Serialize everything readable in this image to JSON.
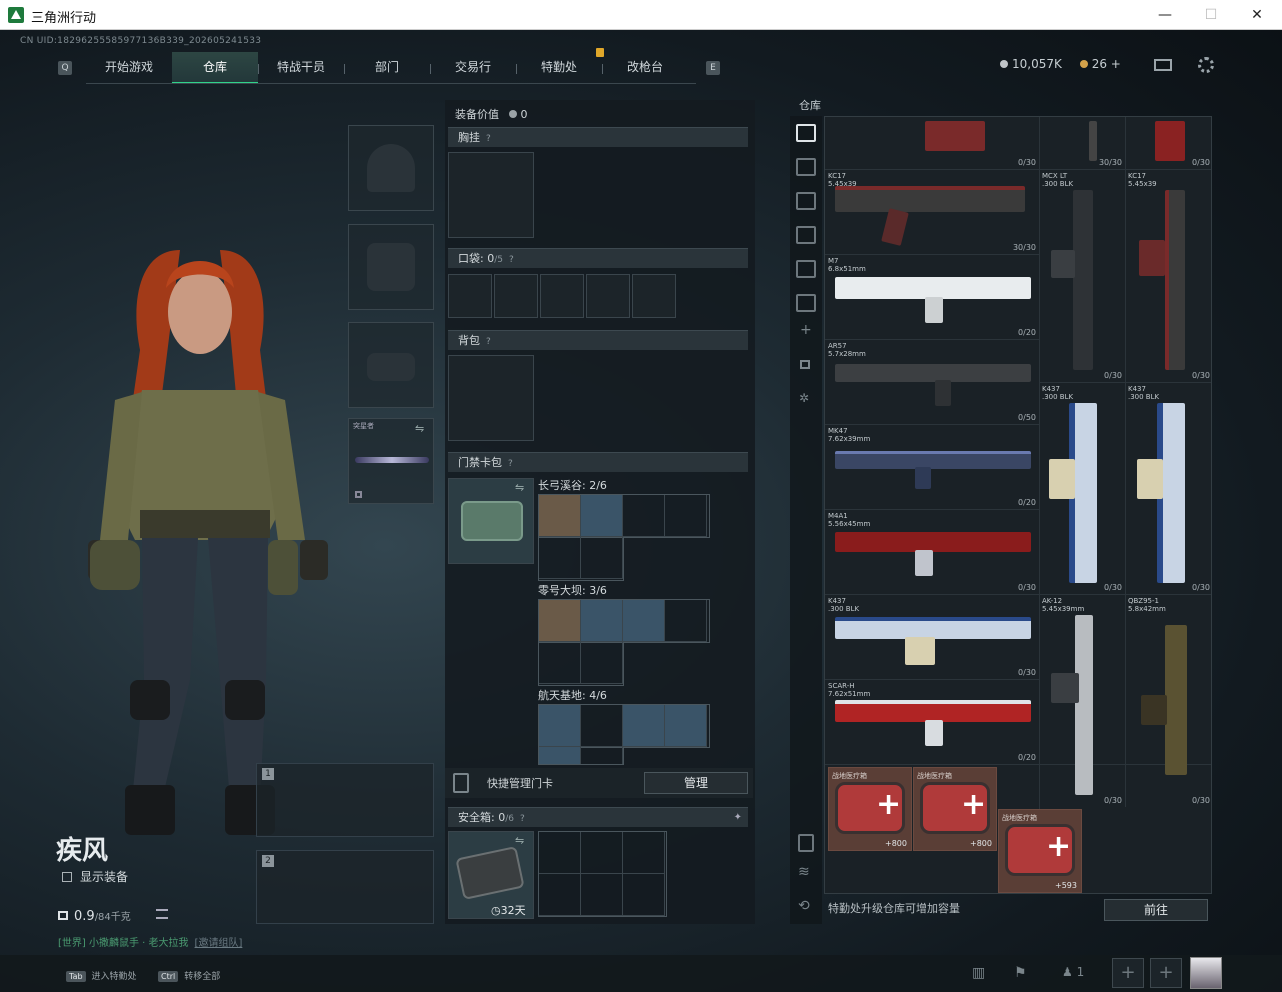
{
  "window": {
    "title": "三角洲行动",
    "minimize": "—",
    "maximize": "☐",
    "close": "✕"
  },
  "uid": "CN UID:18296255585977136B339_202605241533",
  "nav": {
    "left_key": "Q",
    "right_key": "E",
    "tabs": [
      "开始游戏",
      "仓库",
      "特战干员",
      "部门",
      "交易行",
      "特勤处",
      "改枪台"
    ],
    "active": "仓库"
  },
  "currency": {
    "coins": "10,057K",
    "tickets": "26",
    "plus": "+",
    "coin_color": "#c0c4c8",
    "ticket_color": "#d4a24a"
  },
  "character": {
    "name": "疾风",
    "show_equipment": "显示装备",
    "weight_value": "0.9",
    "weight_cap": "/84千克",
    "chat_channel": "[世界]",
    "chat_text": "小撒麟鼠手 · 老大拉我",
    "chat_link": "[邀请组队]"
  },
  "equip_panel": {
    "secure_label": "安全箱",
    "weapon_slot_1": "1",
    "weapon_slot_2": "2",
    "pouch_label": "安全箱"
  },
  "mid": {
    "equip_value_label": "装备价值",
    "equip_value": "0",
    "chest_rig": "胸挂",
    "pockets": "口袋:",
    "pockets_count": "0",
    "pockets_cap": "/5",
    "backpack": "背包",
    "keycard_case": "门禁卡包",
    "groups": [
      {
        "name": "长弓溪谷:",
        "count": "2/6"
      },
      {
        "name": "零号大坝:",
        "count": "3/6"
      },
      {
        "name": "航天基地:",
        "count": "4/6"
      }
    ],
    "quick_manage": "快捷管理门卡",
    "manage_btn": "管理",
    "safe_box": "安全箱:",
    "safe_count": "0",
    "safe_cap": "/6",
    "safe_days": "32天",
    "help": "?"
  },
  "storage": {
    "title": "仓库",
    "footer_text": "特勤处升级仓库可增加容量",
    "go_btn": "前往",
    "weapons": [
      {
        "name": "",
        "caliber": "",
        "count": "0/30"
      },
      {
        "name": "",
        "caliber": "",
        "count": "30/30"
      },
      {
        "name": "",
        "caliber": "",
        "count": "0/30"
      },
      {
        "name": "KC17",
        "caliber": "5.45x39",
        "count": "30/30"
      },
      {
        "name": "MCX LT",
        "caliber": ".300 BLK",
        "count": "0/30"
      },
      {
        "name": "KC17",
        "caliber": "5.45x39",
        "count": "0/30"
      },
      {
        "name": "M7",
        "caliber": "6.8x51mm",
        "count": "0/20"
      },
      {
        "name": "AR57",
        "caliber": "5.7x28mm",
        "count": "0/50"
      },
      {
        "name": "K437",
        "caliber": ".300 BLK",
        "count": "0/30"
      },
      {
        "name": "K437",
        "caliber": ".300 BLK",
        "count": "0/30"
      },
      {
        "name": "MK47",
        "caliber": "7.62x39mm",
        "count": "0/20"
      },
      {
        "name": "M4A1",
        "caliber": "5.56x45mm",
        "count": "0/30"
      },
      {
        "name": "K437",
        "caliber": ".300 BLK",
        "count": "0/30"
      },
      {
        "name": "AK-12",
        "caliber": "5.45x39mm",
        "count": "0/30"
      },
      {
        "name": "QBZ95-1",
        "caliber": "5.8x42mm",
        "count": "0/30"
      },
      {
        "name": "SCAR-H",
        "caliber": "7.62x51mm",
        "count": "0/20"
      }
    ],
    "medkits": [
      {
        "name": "战地医疗箱",
        "count": "+800"
      },
      {
        "name": "战地医疗箱",
        "count": "+800"
      },
      {
        "name": "战地医疗箱",
        "count": "+593"
      }
    ]
  },
  "bottom": {
    "tab_key": "Tab",
    "tab_text": "进入特勤处",
    "ctrl_key": "Ctrl",
    "ctrl_text": "转移全部",
    "friends": "1"
  }
}
